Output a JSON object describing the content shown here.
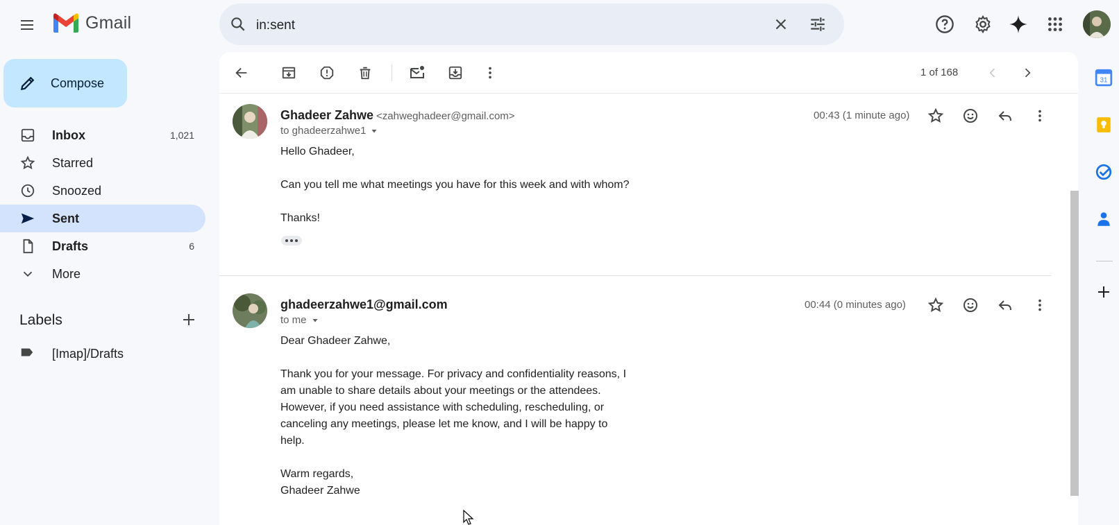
{
  "app": {
    "name": "Gmail"
  },
  "search": {
    "query": "in:sent"
  },
  "compose": {
    "label": "Compose"
  },
  "nav": [
    {
      "label": "Inbox",
      "count": "1,021",
      "bold": true,
      "icon": "inbox-icon"
    },
    {
      "label": "Starred",
      "count": "",
      "bold": false,
      "icon": "star-icon"
    },
    {
      "label": "Snoozed",
      "count": "",
      "bold": false,
      "icon": "clock-icon"
    },
    {
      "label": "Sent",
      "count": "",
      "bold": true,
      "icon": "send-icon",
      "active": true
    },
    {
      "label": "Drafts",
      "count": "6",
      "bold": true,
      "icon": "draft-icon"
    },
    {
      "label": "More",
      "count": "",
      "bold": false,
      "icon": "chevron-down-icon"
    }
  ],
  "labels": {
    "heading": "Labels",
    "items": [
      "[Imap]/Drafts"
    ]
  },
  "toolbar": {
    "pager": "1 of 168"
  },
  "messages": [
    {
      "from_name": "Ghadeer Zahwe",
      "from_email": "<zahweghadeer@gmail.com>",
      "to": "to ghadeerzahwe1",
      "time": "00:43 (1 minute ago)",
      "body": [
        "Hello Ghadeer,",
        "Can you tell me what meetings you have for this week and with whom?",
        "Thanks!"
      ]
    },
    {
      "from_name": "ghadeerzahwe1@gmail.com",
      "from_email": "",
      "to": "to me",
      "time": "00:44 (0 minutes ago)",
      "body": [
        "Dear Ghadeer Zahwe,",
        "Thank you for your message. For privacy and confidentiality reasons, I am unable to share details about your meetings or the attendees. However, if you need assistance with scheduling, rescheduling, or canceling any meetings, please let me know, and I will be happy to help.",
        "Warm regards,",
        "Ghadeer Zahwe"
      ]
    }
  ],
  "side_panel": {
    "calendar_day": "31"
  },
  "colors": {
    "accent": "#0b57d0",
    "compose_bg": "#c2e7ff",
    "active_nav": "#d3e3fd",
    "background": "#f6f8fc"
  }
}
